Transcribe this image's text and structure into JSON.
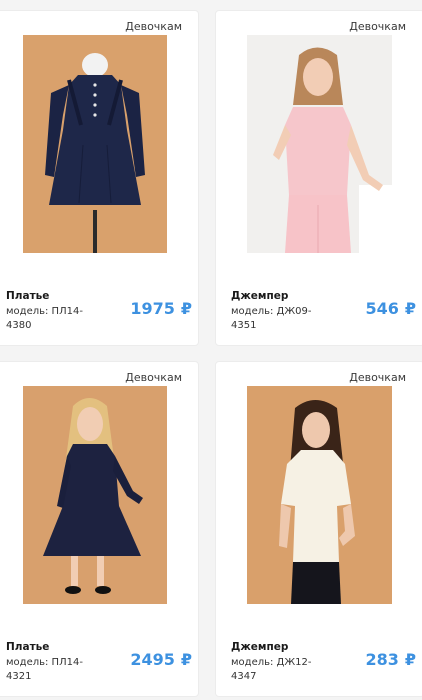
{
  "products": [
    {
      "category": "Девочкам",
      "name": "Платье",
      "model": "модель: ПЛ14-4380",
      "price": "1975",
      "currency": "₽"
    },
    {
      "category": "Девочкам",
      "name": "Джемпер",
      "model": "модель: ДЖ09-4351",
      "price": "546",
      "currency": "₽"
    },
    {
      "category": "Девочкам",
      "name": "Платье",
      "model": "модель: ПЛ14-4321",
      "price": "2495",
      "currency": "₽"
    },
    {
      "category": "Девочкам",
      "name": "Джемпер",
      "model": "модель: ДЖ12-4347",
      "price": "283",
      "currency": "₽"
    }
  ],
  "colors": {
    "price": "#3d91e0",
    "photo_bg_warm": "#d8a06d",
    "photo_bg_light": "#f0efed"
  }
}
